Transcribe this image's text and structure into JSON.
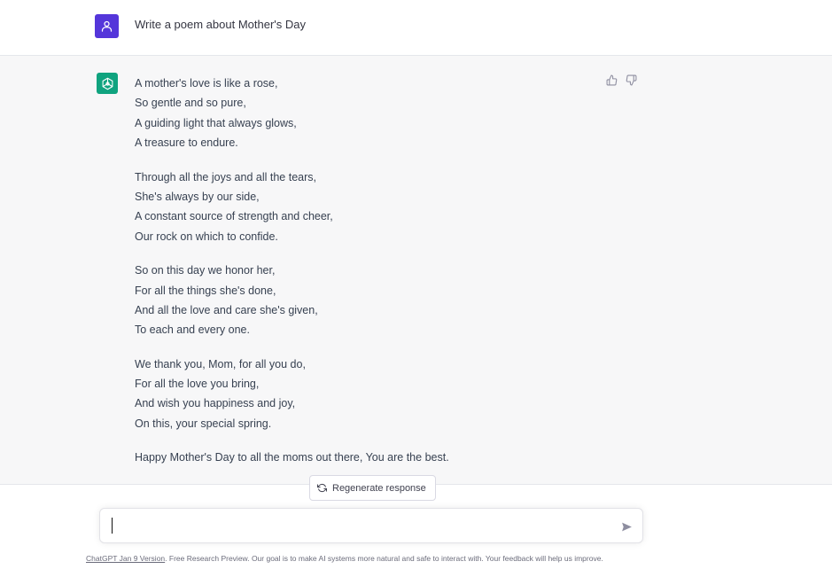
{
  "user_message": {
    "text": "Write a poem about Mother's Day",
    "avatar_icon": "user-icon",
    "avatar_color": "#5436da"
  },
  "assistant_message": {
    "avatar_icon": "openai-logo-icon",
    "avatar_color": "#10a37f",
    "stanzas": [
      {
        "lines": [
          "A mother's love is like a rose,",
          "So gentle and so pure,",
          "A guiding light that always glows,",
          "A treasure to endure."
        ]
      },
      {
        "lines": [
          "Through all the joys and all the tears,",
          "She's always by our side,",
          "A constant source of strength and cheer,",
          "Our rock on which to confide."
        ]
      },
      {
        "lines": [
          "So on this day we honor her,",
          "For all the things she's done,",
          "And all the love and care she's given,",
          "To each and every one."
        ]
      },
      {
        "lines": [
          "We thank you, Mom, for all you do,",
          "For all the love you bring,",
          "And wish you happiness and joy,",
          "On this, your special spring."
        ]
      }
    ],
    "closing": "Happy Mother's Day to all the moms out there, You are the best.",
    "feedback": {
      "thumbs_up_icon": "thumbs-up-icon",
      "thumbs_down_icon": "thumbs-down-icon"
    }
  },
  "regenerate": {
    "label": "Regenerate response",
    "icon": "refresh-icon"
  },
  "composer": {
    "value": "",
    "send_icon": "send-icon"
  },
  "footer": {
    "version_link": "ChatGPT Jan 9 Version",
    "text": ". Free Research Preview. Our goal is to make AI systems more natural and safe to interact with. Your feedback will help us improve."
  }
}
